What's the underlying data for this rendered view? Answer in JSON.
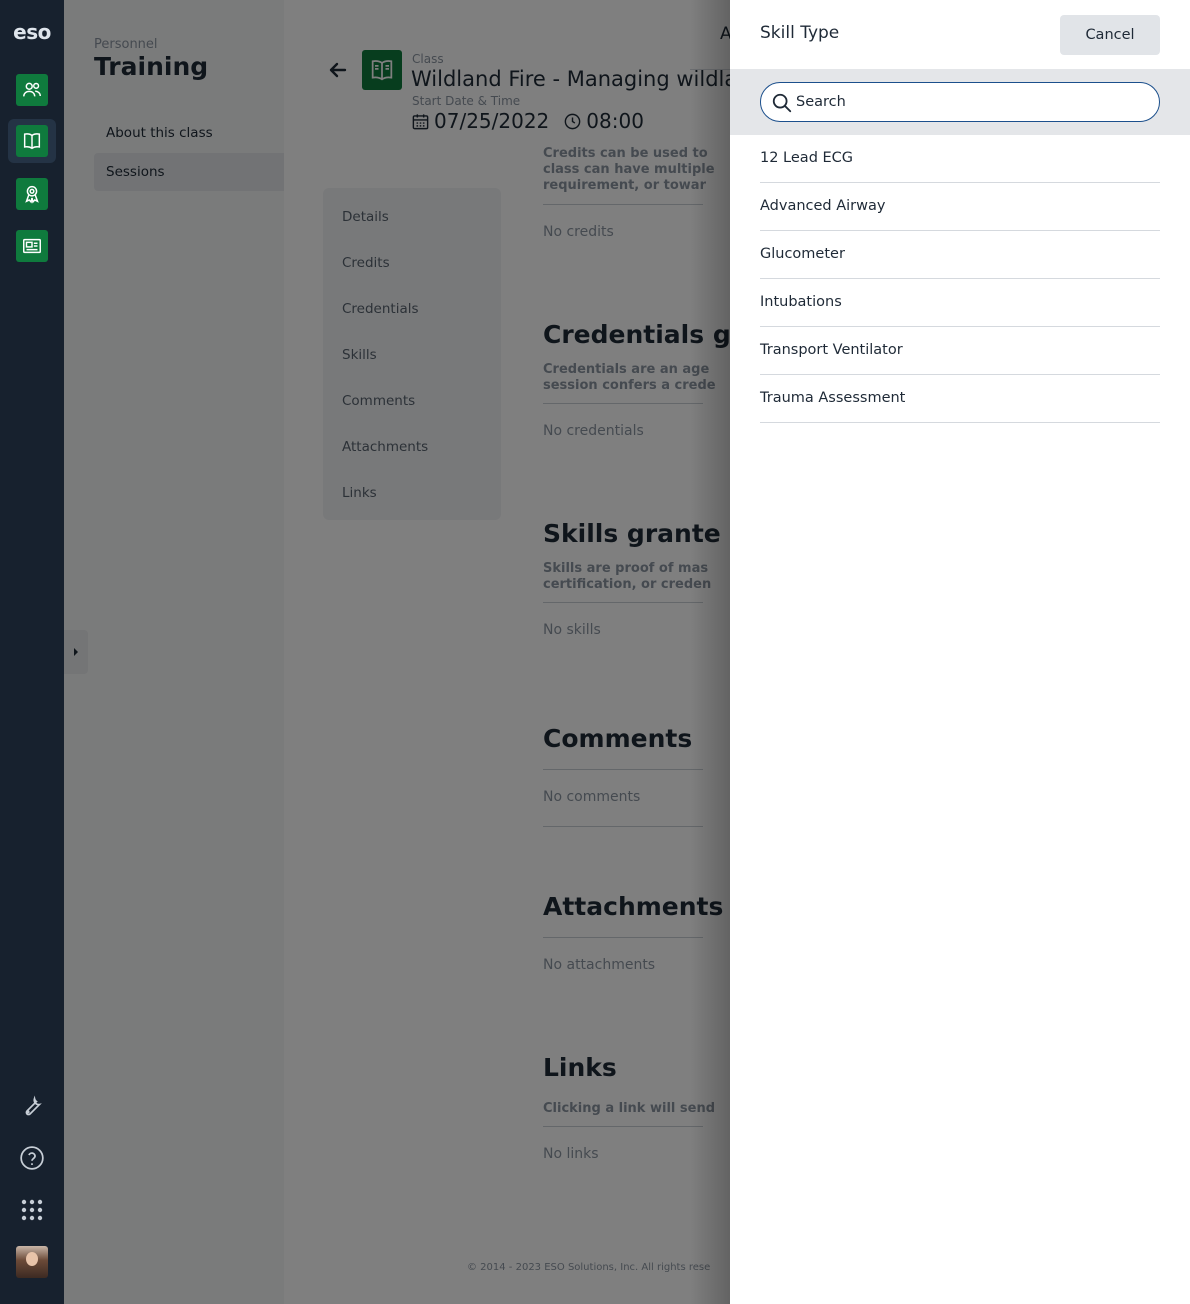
{
  "rail": {
    "logo": "eso",
    "items": [
      {
        "icon": "people-icon"
      },
      {
        "icon": "book-icon"
      },
      {
        "icon": "award-ribbon-icon"
      },
      {
        "icon": "newspaper-icon"
      }
    ],
    "bottom": [
      {
        "icon": "wrench-icon"
      },
      {
        "icon": "help-icon"
      },
      {
        "icon": "app-grid-icon"
      }
    ]
  },
  "nav": {
    "breadcrumb": "Personnel",
    "title": "Training",
    "items": [
      {
        "label": "About this class",
        "selected": false
      },
      {
        "label": "Sessions",
        "selected": true
      }
    ]
  },
  "header": {
    "class_label": "Class",
    "class_title": "Wildland Fire - Managing wildland",
    "start_label": "Start Date & Time",
    "date": "07/25/2022",
    "time": "08:00",
    "clipped_letter": "A"
  },
  "section_nav": [
    "Details",
    "Credits",
    "Credentials",
    "Skills",
    "Comments",
    "Attachments",
    "Links"
  ],
  "sections": {
    "credits": {
      "desc_lines": [
        "Credits can be used to",
        "class can have multiple",
        "requirement, or towar"
      ],
      "empty": "No credits"
    },
    "credentials": {
      "title": "Credentials g",
      "desc_lines": [
        "Credentials are an age",
        "session confers a crede"
      ],
      "empty": "No credentials"
    },
    "skills": {
      "title": "Skills grante",
      "desc_lines": [
        "Skills are proof of mas",
        "certification, or creden"
      ],
      "empty": "No skills"
    },
    "comments": {
      "title": "Comments",
      "empty": "No comments"
    },
    "attachments": {
      "title": "Attachments",
      "empty": "No attachments"
    },
    "links": {
      "title": "Links",
      "desc": "Clicking a link will send",
      "empty": "No links"
    }
  },
  "footer": "© 2014 - 2023 ESO Solutions, Inc. All rights rese",
  "drawer": {
    "title": "Skill Type",
    "cancel_label": "Cancel",
    "search": {
      "placeholder": "Search",
      "value": ""
    },
    "items": [
      "12 Lead ECG",
      "Advanced Airway",
      "Glucometer",
      "Intubations",
      "Transport Ventilator",
      "Trauma Assessment"
    ]
  },
  "colors": {
    "rail_bg": "#17212e",
    "brand_green": "#0f7a3d",
    "search_border": "#1b4f8c",
    "text": "#1f2a37",
    "muted": "#8b95a1"
  }
}
